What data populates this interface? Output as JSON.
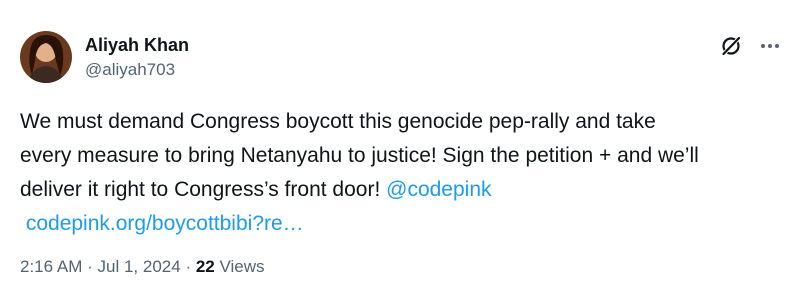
{
  "author": {
    "name": "Aliyah Khan",
    "handle": "@aliyah703",
    "avatar_icon": "profile-photo"
  },
  "header_icons": {
    "grok": "grok-icon",
    "more": "more-icon"
  },
  "tweet": {
    "line1": "We must demand Congress boycott this genocide pep-rally and take",
    "line2": "every measure to bring Netanyahu to justice! Sign the petition + and we’ll",
    "line3": "deliver it right to Congress’s front door! ",
    "mention": "@codepink",
    "url": "codepink.org/boycottbibi?re…"
  },
  "meta": {
    "time": "2:16 AM",
    "separator": "·",
    "date": "Jul 1, 2024",
    "views_count": "22",
    "views_label": "Views"
  },
  "colors": {
    "text": "#0f1419",
    "secondary": "#536471",
    "link": "#1d9bf0"
  }
}
